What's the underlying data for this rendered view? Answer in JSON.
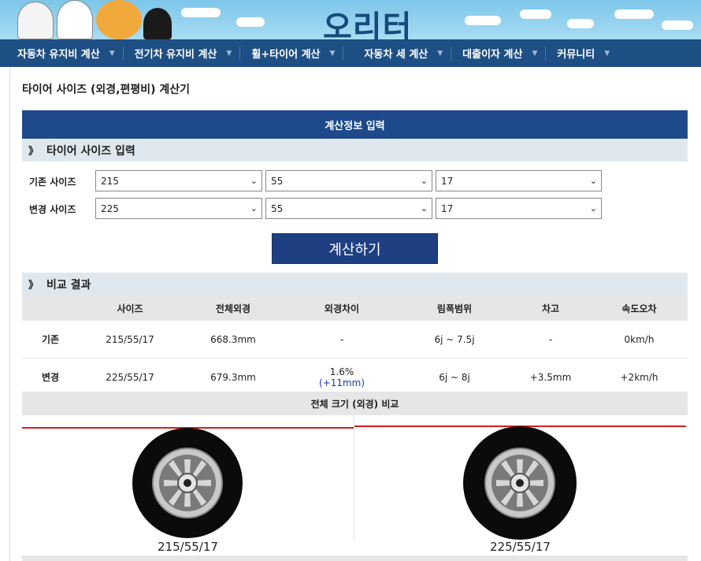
{
  "site": {
    "logo_text": "오리터"
  },
  "nav": {
    "items": [
      {
        "label": "자동차 유지비 계산"
      },
      {
        "label": "전기차 유지비 계산"
      },
      {
        "label": "휠+타이어 계산"
      },
      {
        "label": "자동차 세 계산"
      },
      {
        "label": "대출이자 계산"
      },
      {
        "label": "커뮤니티"
      }
    ],
    "caret": "▼"
  },
  "page": {
    "title": "타이어 사이즈 (외경,편평비) 계산기"
  },
  "input_section": {
    "bar_title": "계산정보 입력",
    "header": "타이어 사이즈 입력",
    "chevron": "》",
    "current_label": "기존 사이즈",
    "new_label": "변경 사이즈",
    "current": {
      "width": "215",
      "aspect": "55",
      "rim": "17"
    },
    "new": {
      "width": "225",
      "aspect": "55",
      "rim": "17"
    },
    "dropdown_glyph": "⌄",
    "calc_button": "계산하기"
  },
  "result_section": {
    "header": "비교 결과",
    "chevron": "》",
    "columns": [
      "",
      "사이즈",
      "전체외경",
      "외경차이",
      "림폭범위",
      "차고",
      "속도오차"
    ],
    "rows": [
      {
        "label": "기존",
        "size": "215/55/17",
        "diameter": "668.3mm",
        "diff": "-",
        "diff_sub": "",
        "rim": "6j ~ 7.5j",
        "height": "-",
        "speed": "0km/h"
      },
      {
        "label": "변경",
        "size": "225/55/17",
        "diameter": "679.3mm",
        "diff": "1.6%",
        "diff_sub": "(+11mm)",
        "rim": "6j ~ 8j",
        "height": "+3.5mm",
        "speed": "+2km/h"
      }
    ],
    "compare_header": "전체 크기 (외경) 비교",
    "tires": [
      {
        "label": "215/55/17"
      },
      {
        "label": "225/55/17"
      }
    ]
  },
  "colors": {
    "nav_bg": "#1e4f84",
    "bar_bg": "#1e4a8c",
    "button_bg": "#1e3f82",
    "diff_blue": "#1a37b5",
    "ref_line": "#d61f1f"
  }
}
